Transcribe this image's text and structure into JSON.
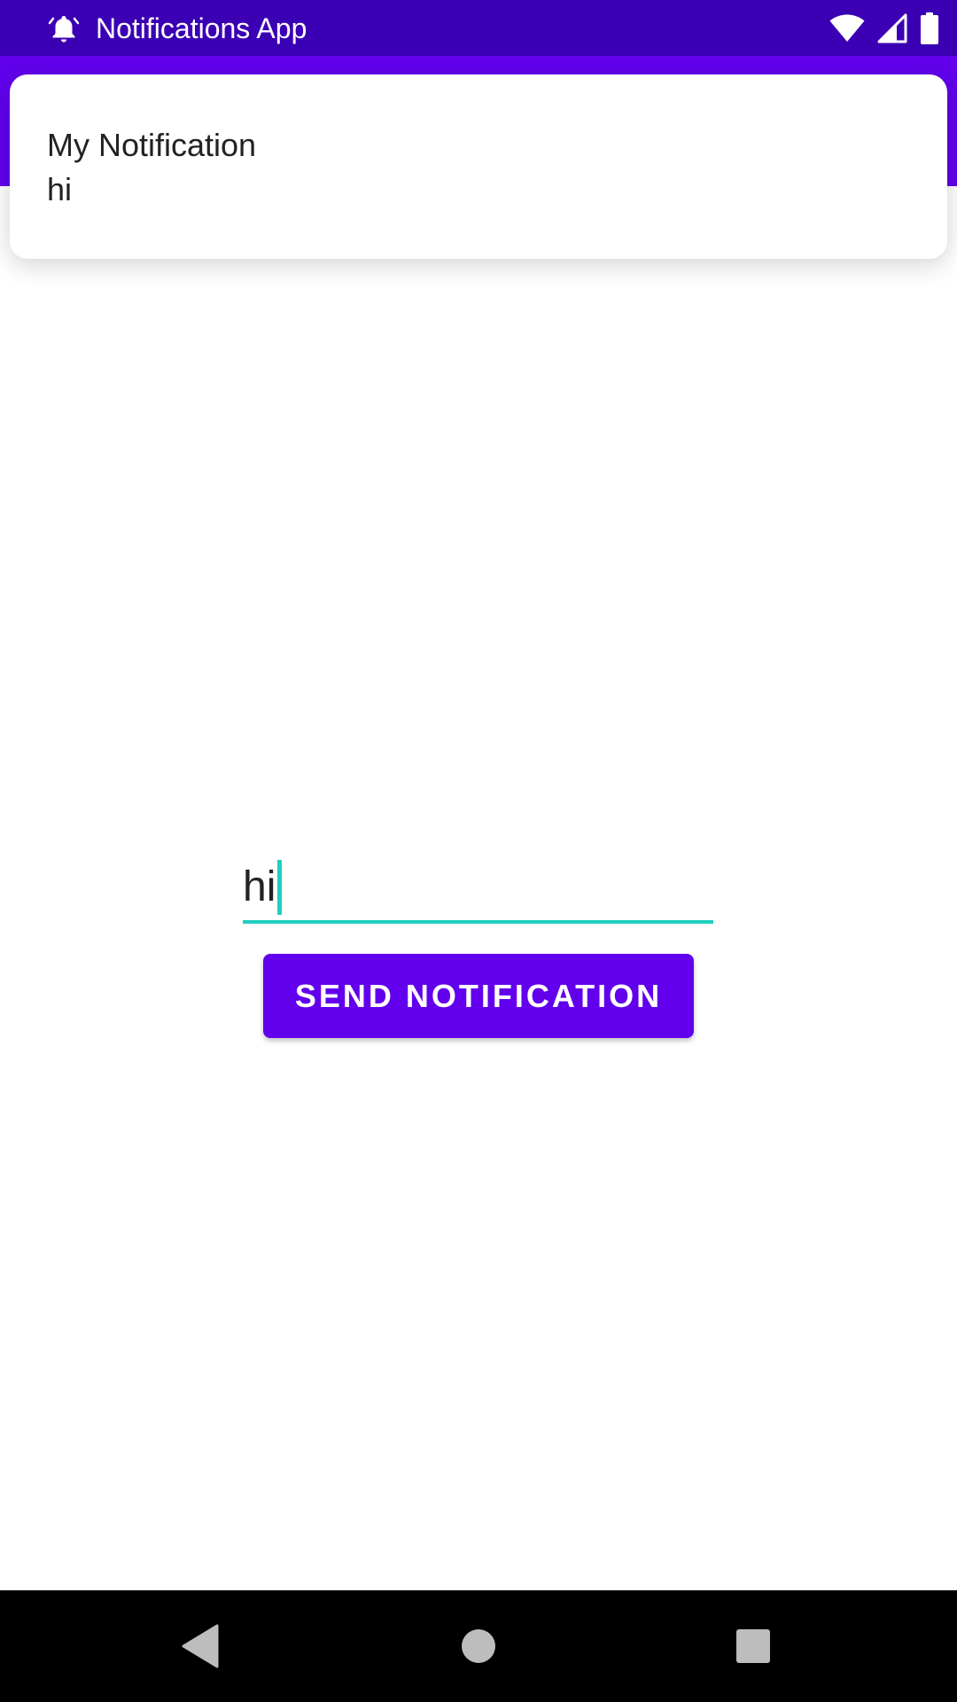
{
  "status_bar": {
    "app_title": "Notifications App",
    "icons": [
      "bell-icon",
      "wifi-icon",
      "signal-icon",
      "battery-icon"
    ]
  },
  "notification": {
    "title": "My Notification",
    "body": "hi"
  },
  "input": {
    "value": "hi"
  },
  "send_button": {
    "label": "SEND NOTIFICATION"
  },
  "nav_bar": {
    "buttons": [
      "back-icon",
      "home-icon",
      "recents-icon"
    ]
  },
  "colors": {
    "status_bar": "#3b00b3",
    "app_bar": "#6200ee",
    "accent": "#1fcfbf",
    "button": "#6200ee"
  }
}
